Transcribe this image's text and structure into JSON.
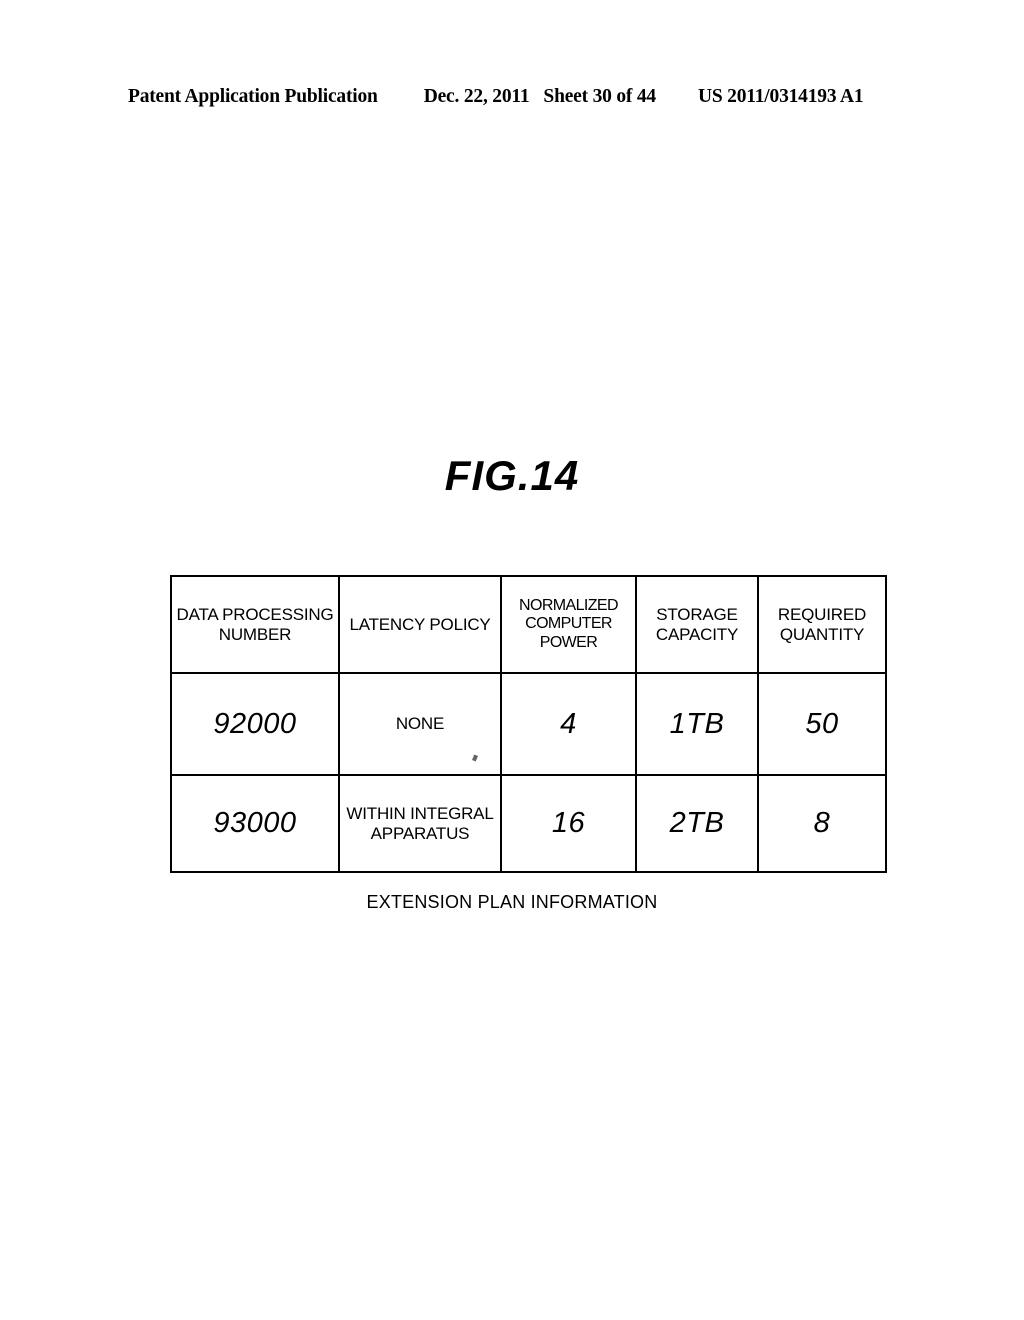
{
  "page_header": {
    "publication": "Patent Application Publication",
    "date": "Dec. 22, 2011",
    "sheet": "Sheet 30 of 44",
    "document_number": "US 2011/0314193 A1"
  },
  "figure": {
    "title": "FIG.14",
    "caption": "EXTENSION PLAN INFORMATION"
  },
  "table": {
    "headers": [
      "DATA PROCESSING NUMBER",
      "LATENCY POLICY",
      "NORMALIZED COMPUTER POWER",
      "STORAGE CAPACITY",
      "REQUIRED QUANTITY"
    ],
    "rows": [
      {
        "data_processing_number": "92000",
        "latency_policy": "NONE",
        "normalized_computer_power": "4",
        "storage_capacity": "1TB",
        "required_quantity": "50"
      },
      {
        "data_processing_number": "93000",
        "latency_policy": "WITHIN INTEGRAL APPARATUS",
        "normalized_computer_power": "16",
        "storage_capacity": "2TB",
        "required_quantity": "8"
      }
    ]
  },
  "colors": {
    "ink": "#000000",
    "paper": "#ffffff"
  }
}
